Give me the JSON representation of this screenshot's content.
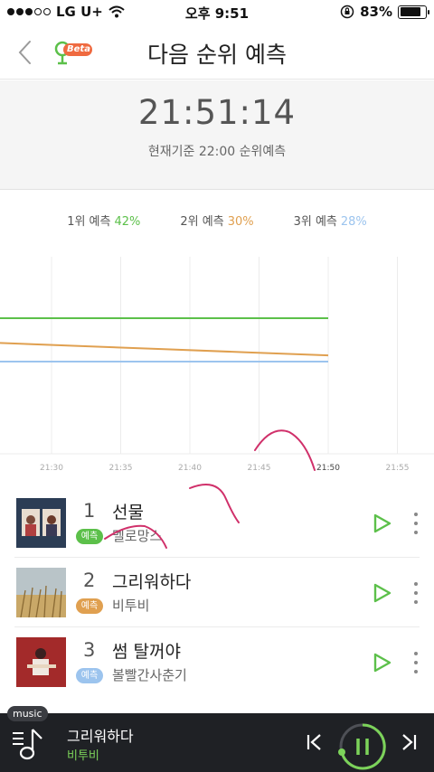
{
  "status_bar": {
    "carrier": "LG U+",
    "time": "오후 9:51",
    "battery": "83%",
    "battery_level": 0.83
  },
  "header": {
    "title": "다음 순위 예측",
    "beta_label": "Beta",
    "back_icon": "chevron-left-icon"
  },
  "clock": {
    "time": "21:51:14",
    "subtitle": "현재기준 22:00 순위예측"
  },
  "legend": [
    {
      "label": "1위 예측",
      "pct": "42%",
      "color": "#5cc04a"
    },
    {
      "label": "2위 예측",
      "pct": "30%",
      "color": "#e0a050"
    },
    {
      "label": "3위 예측",
      "pct": "28%",
      "color": "#9cc4ee"
    }
  ],
  "chart_data": {
    "type": "line",
    "x": [
      "21:30",
      "21:35",
      "21:40",
      "21:45",
      "21:50",
      "21:55"
    ],
    "highlighted_x": "21:50",
    "grid": true,
    "series": [
      {
        "name": "1위 예측",
        "color": "#5cc04a",
        "values": [
          42,
          42,
          42,
          42,
          42
        ]
      },
      {
        "name": "2위 예측",
        "color": "#e0a050",
        "values": [
          34,
          33,
          32,
          31,
          30
        ]
      },
      {
        "name": "3위 예측",
        "color": "#9cc4ee",
        "values": [
          28,
          28,
          28,
          28,
          28
        ]
      }
    ]
  },
  "ranks": [
    {
      "rank": "1",
      "title": "선물",
      "artist": "멜로망스",
      "badge": "예측",
      "badge_color": "#5cc04a",
      "album_color": "#2c3d55"
    },
    {
      "rank": "2",
      "title": "그리워하다",
      "artist": "비투비",
      "badge": "예측",
      "badge_color": "#e0a050",
      "album_color": "#c8b890"
    },
    {
      "rank": "3",
      "title": "썸 탈꺼야",
      "artist": "볼빨간사춘기",
      "badge": "예측",
      "badge_color": "#9cc4ee",
      "album_color": "#a32a2a"
    }
  ],
  "player": {
    "tag": "music",
    "title": "그리워하다",
    "artist": "비투비",
    "accent": "#7cd35a"
  }
}
